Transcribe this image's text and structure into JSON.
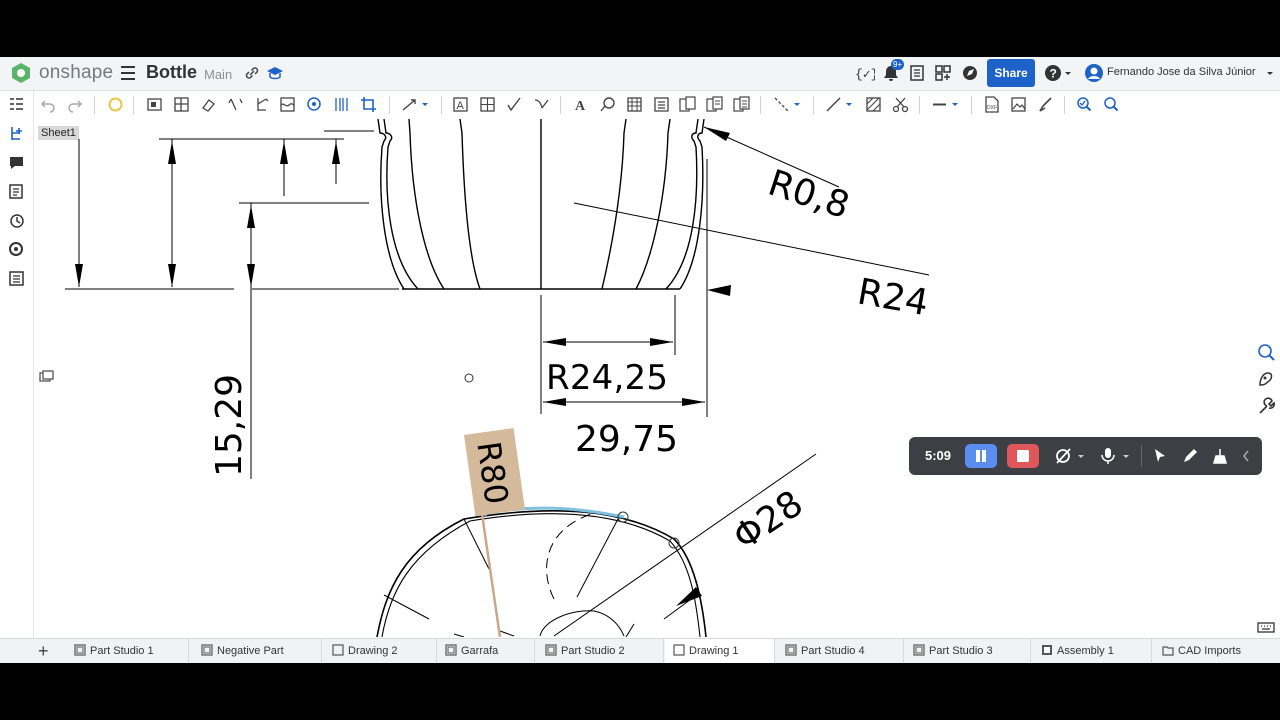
{
  "header": {
    "brand": "onshape",
    "doc_title": "Bottle",
    "branch": "Main",
    "notif_count": "9+",
    "share_label": "Share",
    "user_name": "Fernando Jose da Silva Júnior"
  },
  "sheet_label": "Sheet1",
  "drawing": {
    "dim_r08": "R0,8",
    "dim_r24": "R24",
    "dim_r2425": "R24,25",
    "dim_2975": "29,75",
    "dim_1529": "15,29",
    "dim_r80": "R80",
    "dim_phi28": "Φ28"
  },
  "recorder": {
    "time": "5:09"
  },
  "tabs": [
    {
      "label": "Part Studio 1",
      "icon": "part-studio-icon"
    },
    {
      "label": "Negative Part",
      "icon": "part-studio-icon"
    },
    {
      "label": "Drawing 2",
      "icon": "drawing-icon"
    },
    {
      "label": "Garrafa",
      "icon": "part-studio-icon"
    },
    {
      "label": "Part Studio 2",
      "icon": "part-studio-icon"
    },
    {
      "label": "Drawing 1",
      "icon": "drawing-icon",
      "active": true
    },
    {
      "label": "Part Studio 4",
      "icon": "part-studio-icon"
    },
    {
      "label": "Part Studio 3",
      "icon": "part-studio-icon"
    },
    {
      "label": "Assembly 1",
      "icon": "assembly-icon"
    },
    {
      "label": "CAD Imports",
      "icon": "folder-icon"
    }
  ],
  "colors": {
    "accent": "#1d62c9",
    "dim_tag": "#d4b99a",
    "highlight_curve": "#7fc0e0"
  }
}
